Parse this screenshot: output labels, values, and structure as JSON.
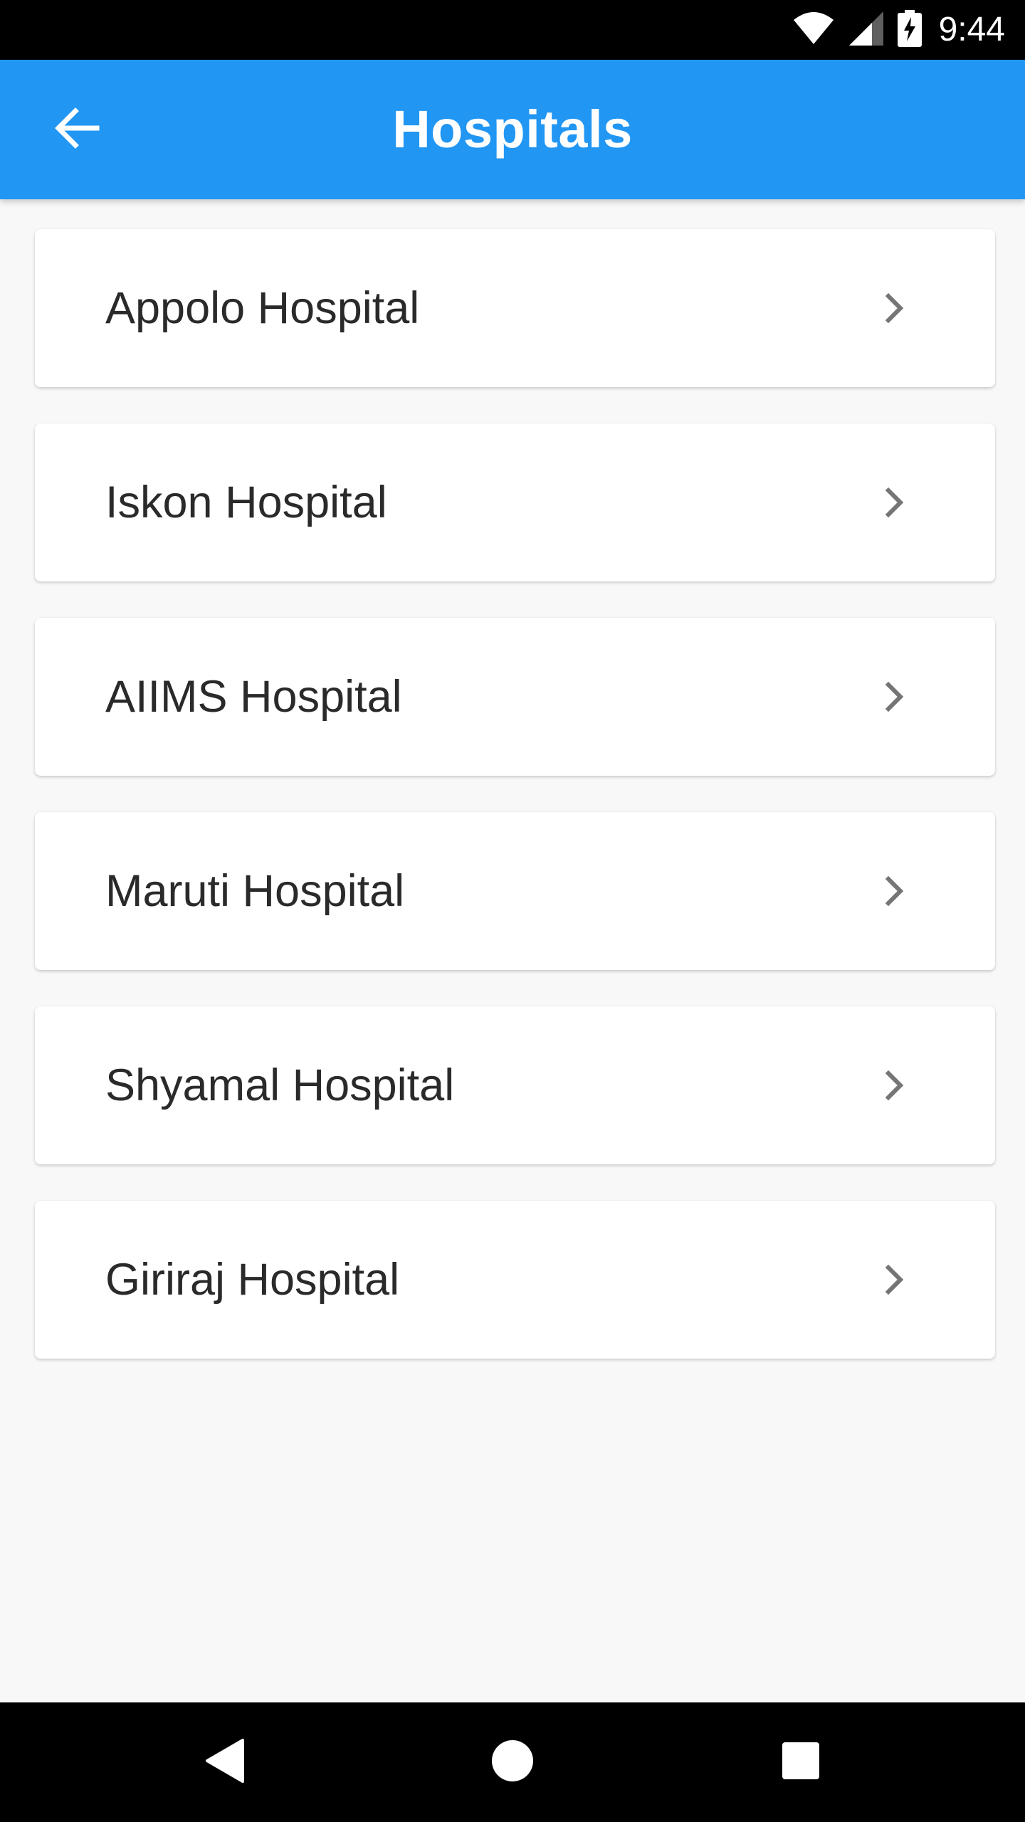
{
  "status_bar": {
    "time": "9:44",
    "icons": [
      "wifi-icon",
      "cellular-signal-icon",
      "battery-charging-icon"
    ]
  },
  "app_bar": {
    "title": "Hospitals",
    "back_icon": "arrow-left-icon",
    "color": "#2196F3"
  },
  "hospitals": [
    {
      "name": "Appolo Hospital",
      "icon": "chevron-right-icon"
    },
    {
      "name": "Iskon Hospital",
      "icon": "chevron-right-icon"
    },
    {
      "name": "AIIMS Hospital",
      "icon": "chevron-right-icon"
    },
    {
      "name": "Maruti Hospital",
      "icon": "chevron-right-icon"
    },
    {
      "name": "Shyamal Hospital",
      "icon": "chevron-right-icon"
    },
    {
      "name": "Giriraj Hospital",
      "icon": "chevron-right-icon"
    }
  ],
  "nav_bar": {
    "buttons": [
      "back-triangle-icon",
      "home-circle-icon",
      "recents-square-icon"
    ]
  }
}
